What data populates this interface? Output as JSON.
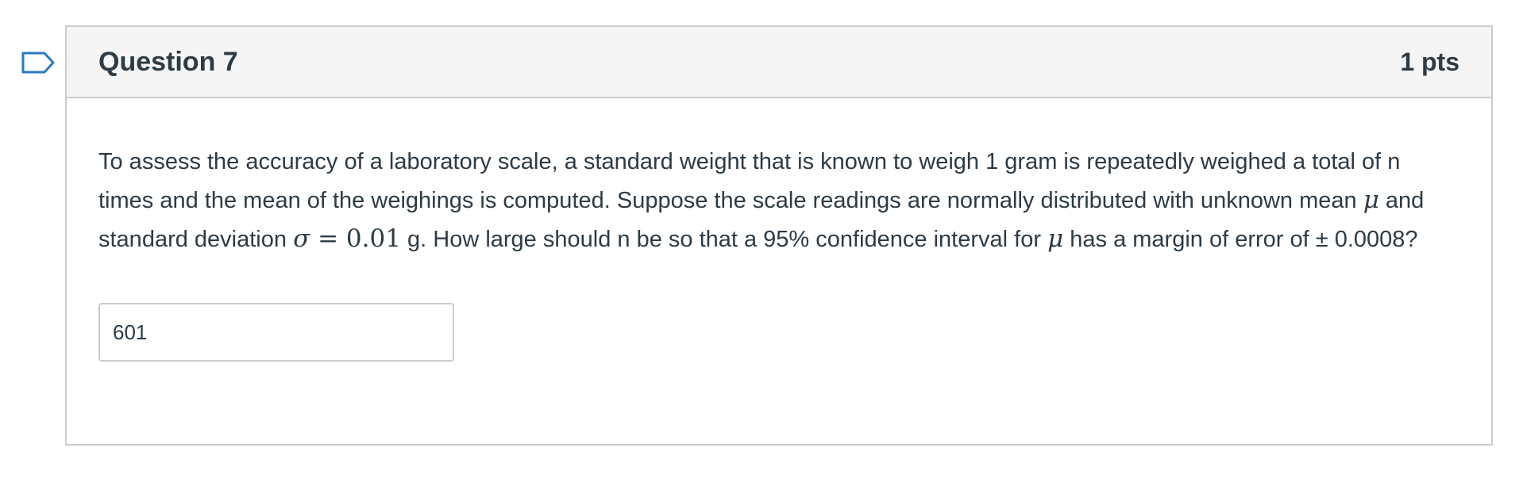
{
  "question": {
    "title": "Question 7",
    "points": "1 pts",
    "text": {
      "part1": "To assess the accuracy of a laboratory scale, a standard weight that is known to weigh 1 gram is repeatedly weighed a total of n times and the mean of the weighings is computed. Suppose the scale readings are normally distributed with unknown mean ",
      "mu": "μ",
      "part2": " and standard deviation ",
      "sigma": "σ",
      "equals": " = ",
      "sigma_value": "0.01",
      "part3": " g. How large should n be so that a 95% confidence interval for ",
      "mu2": "μ",
      "part4": " has a margin of error of ± 0.0008?"
    },
    "answer_value": "601"
  },
  "colors": {
    "accent": "#2b7abc",
    "border": "#c7cdd1",
    "header_bg": "#f5f5f5",
    "text": "#2d3b45"
  },
  "icons": {
    "flag": "flag-question-icon"
  }
}
